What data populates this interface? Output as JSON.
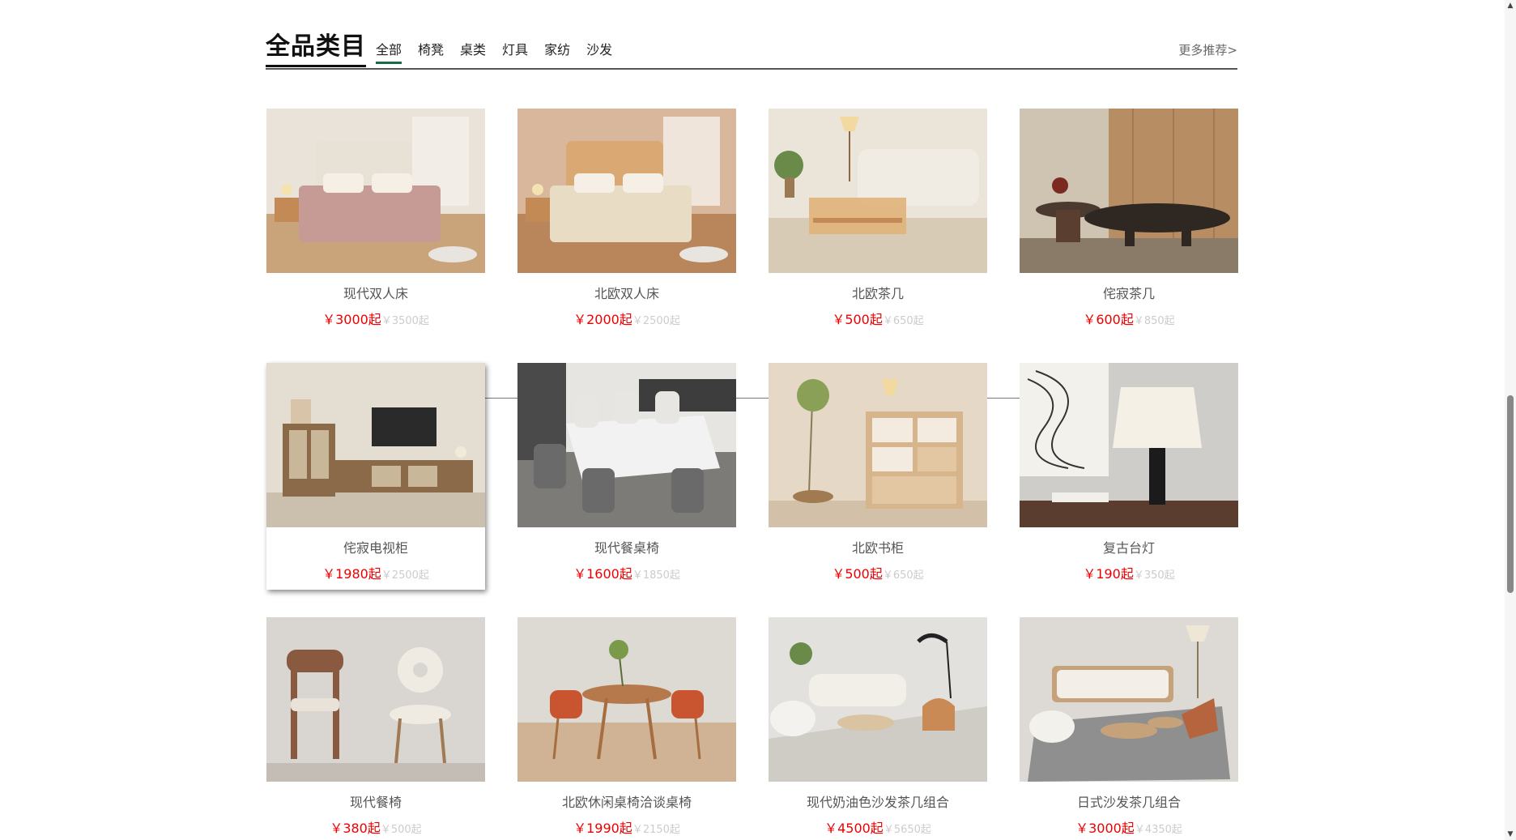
{
  "header": {
    "title": "全品类目",
    "tabs": [
      {
        "label": "全部",
        "active": true
      },
      {
        "label": "椅凳"
      },
      {
        "label": "桌类"
      },
      {
        "label": "灯具"
      },
      {
        "label": "家纺"
      },
      {
        "label": "沙发"
      }
    ],
    "more_label": "更多推荐>"
  },
  "products": [
    {
      "name": "现代双人床",
      "price": "￥3000起",
      "old_price": "￥3500起",
      "image": "bed-icon"
    },
    {
      "name": "北欧双人床",
      "price": "￥2000起",
      "old_price": "￥2500起",
      "image": "bed-icon"
    },
    {
      "name": "北欧茶几",
      "price": "￥500起",
      "old_price": "￥650起",
      "image": "coffee-table-icon"
    },
    {
      "name": "侘寂茶几",
      "price": "￥600起",
      "old_price": "￥850起",
      "image": "coffee-table-icon"
    },
    {
      "name": "侘寂电视柜",
      "price": "￥1980起",
      "old_price": "￥2500起",
      "image": "tv-cabinet-icon",
      "hovered": true
    },
    {
      "name": "现代餐桌椅",
      "price": "￥1600起",
      "old_price": "￥1850起",
      "image": "dining-set-icon"
    },
    {
      "name": "北欧书柜",
      "price": "￥500起",
      "old_price": "￥650起",
      "image": "bookcase-icon"
    },
    {
      "name": "复古台灯",
      "price": "￥190起",
      "old_price": "￥350起",
      "image": "table-lamp-icon"
    },
    {
      "name": "现代餐椅",
      "price": "￥380起",
      "old_price": "￥500起",
      "image": "chair-icon"
    },
    {
      "name": "北欧休闲桌椅洽谈桌椅",
      "price": "￥1990起",
      "old_price": "￥2150起",
      "image": "dining-set-icon"
    },
    {
      "name": "现代奶油色沙发茶几组合",
      "price": "￥4500起",
      "old_price": "￥5650起",
      "image": "sofa-icon"
    },
    {
      "name": "日式沙发茶几组合",
      "price": "￥3000起",
      "old_price": "￥4350起",
      "image": "sofa-icon"
    }
  ],
  "colors": {
    "accent_tab": "#1b6b4a",
    "price": "#e00000",
    "old_price": "#cccccc"
  },
  "scrollbar": {
    "up_icon": "arrow-up-icon",
    "down_icon": "arrow-down-icon"
  }
}
